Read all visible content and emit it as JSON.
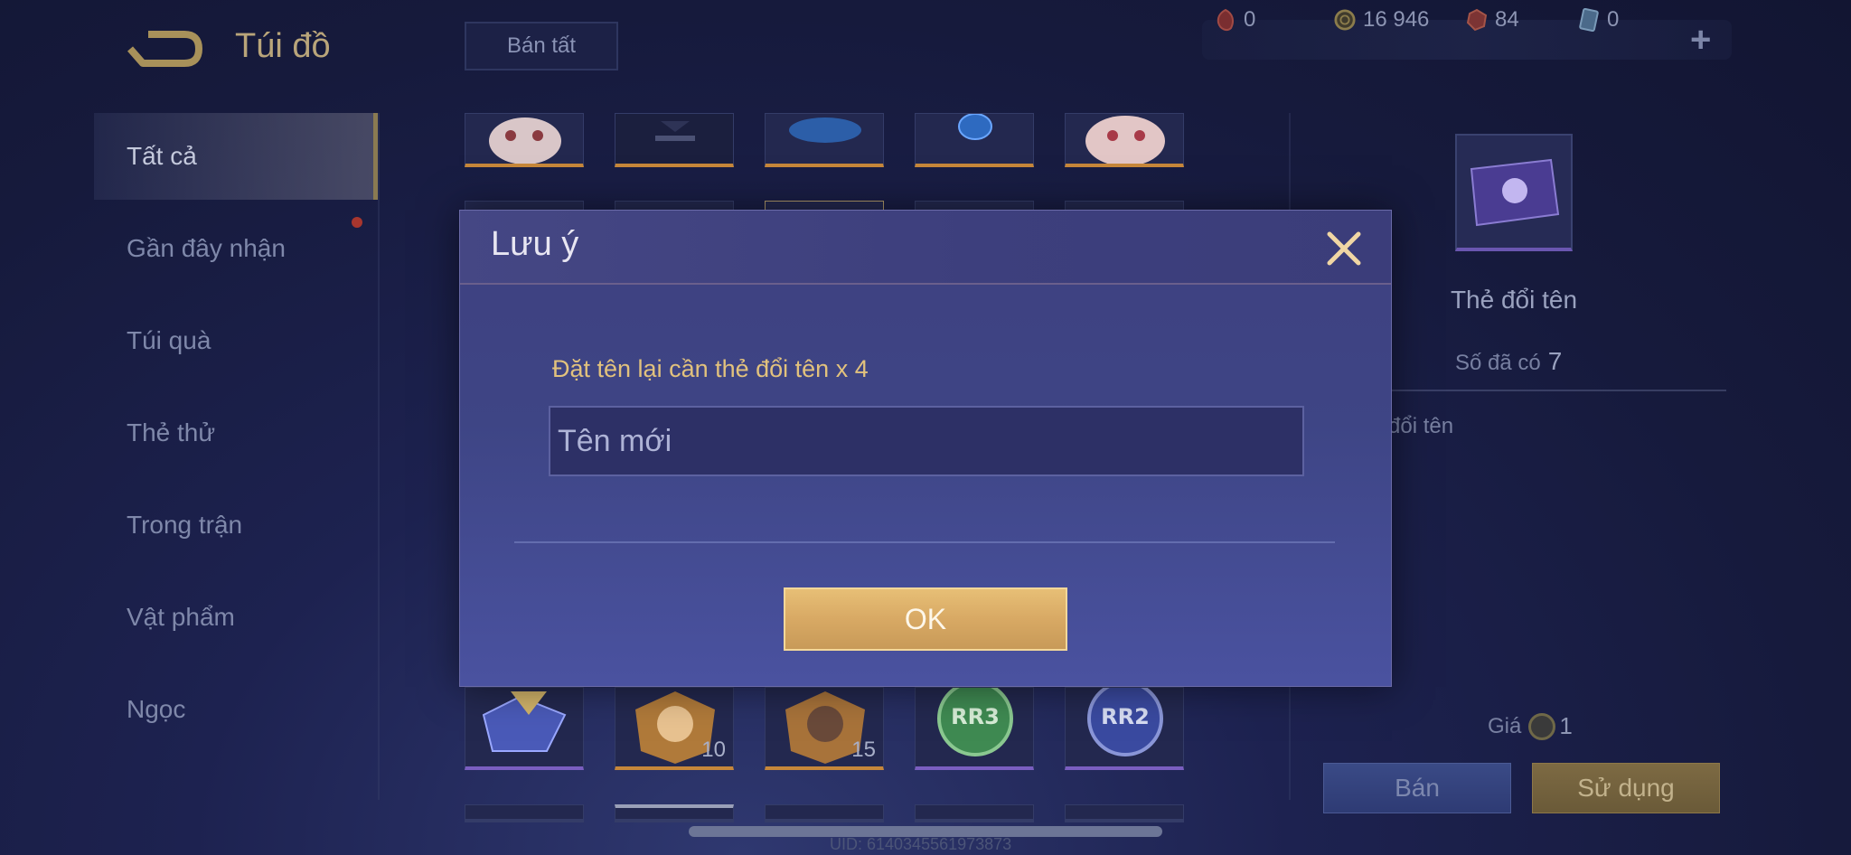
{
  "header": {
    "title": "Túi đồ",
    "sell_all": "Bán tất"
  },
  "currencies": [
    {
      "icon": "red-token-icon",
      "value": "0"
    },
    {
      "icon": "gold-coin-icon",
      "value": "16 946"
    },
    {
      "icon": "ruby-icon",
      "value": "84"
    },
    {
      "icon": "card-icon",
      "value": "0"
    }
  ],
  "sidebar": {
    "items": [
      {
        "label": "Tất cả"
      },
      {
        "label": "Gần đây nhận"
      },
      {
        "label": "Túi quà"
      },
      {
        "label": "Thẻ thử"
      },
      {
        "label": "Trong trận"
      },
      {
        "label": "Vật phẩm"
      },
      {
        "label": "Ngọc"
      }
    ]
  },
  "grid": {
    "counts": [
      "10",
      "15"
    ],
    "badges": [
      "RR3",
      "RR2"
    ]
  },
  "detail": {
    "name": "Thẻ đổi tên",
    "owned_label": "Số đã có",
    "owned_value": "7",
    "desc": "đổi tên",
    "price_label": "Giá",
    "price_value": "1",
    "sell": "Bán",
    "use": "Sử dụng"
  },
  "footer": {
    "uid": "UID: 6140345561973873"
  },
  "modal": {
    "title": "Lưu ý",
    "message": "Đặt tên lại cần thẻ đổi tên x 4",
    "placeholder": "Tên mới",
    "ok": "OK"
  },
  "colors": {
    "gold_accent": "#d8a964",
    "modal_bg": "#3e4585",
    "message_text": "#e2c27d"
  }
}
